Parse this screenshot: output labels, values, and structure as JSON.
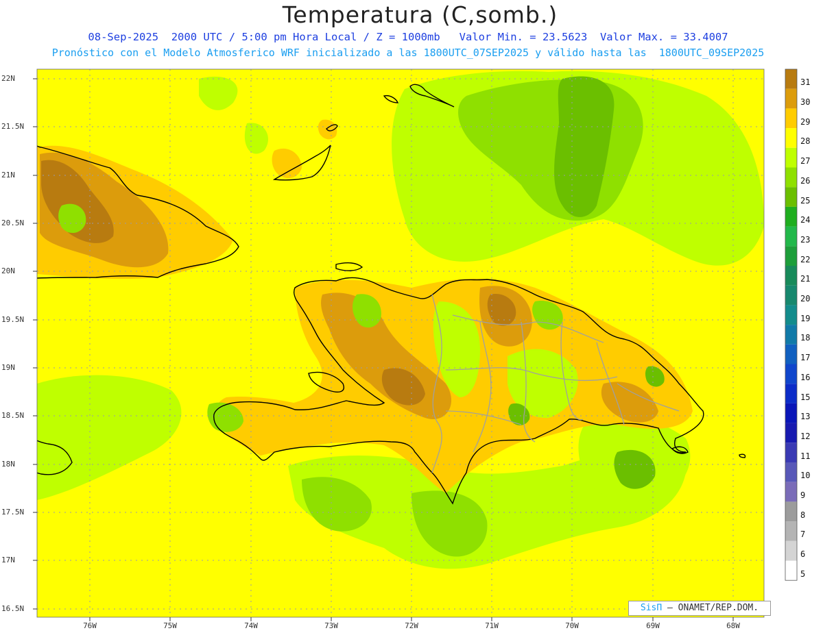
{
  "header": {
    "title": "Temperatura (C,somb.)",
    "line1": "08-Sep-2025  2000 UTC / 5:00 pm Hora Local / Z = 1000mb   Valor Min. = 23.5623  Valor Max. = 33.4007",
    "line2": "Pronóstico con el Modelo Atmosferico WRF inicializado a las 1800UTC_07SEP2025 y válido hasta las  1800UTC_09SEP2025"
  },
  "axes": {
    "lat_labels": [
      "22N",
      "21.5N",
      "21N",
      "20.5N",
      "20N",
      "19.5N",
      "19N",
      "18.5N",
      "18N",
      "17.5N",
      "17N",
      "16.5N"
    ],
    "lon_labels": [
      "76W",
      "75W",
      "74W",
      "73W",
      "72W",
      "71W",
      "70W",
      "69W",
      "68W"
    ]
  },
  "colorbar": {
    "labels": [
      "31",
      "30",
      "29",
      "28",
      "27",
      "26",
      "25",
      "24",
      "23",
      "22",
      "21",
      "20",
      "19",
      "18",
      "17",
      "16",
      "15",
      "13",
      "12",
      "11",
      "10",
      "9",
      "8",
      "7",
      "6",
      "5"
    ],
    "colors": [
      "#b87b10",
      "#dc9c0c",
      "#ffcc00",
      "#ffff00",
      "#bfff00",
      "#8fe000",
      "#6bbf00",
      "#1fae1f",
      "#22b84a",
      "#1d9e3a",
      "#188a5a",
      "#17886e",
      "#138c8c",
      "#117aa8",
      "#1160c0",
      "#1046cc",
      "#0c2cc8",
      "#0a16b8",
      "#181ab0",
      "#3a3ab4",
      "#5858b8",
      "#7a6cb8",
      "#9c9c9c",
      "#b4b4b4",
      "#d4d4d4",
      "#ffffff"
    ]
  },
  "map_colors": {
    "ocean": "#ffff00",
    "warm_land": "#ffcc00",
    "hot": "#dc9c0c",
    "hottest": "#b87b10",
    "cool": "#bfff00",
    "cooler": "#8fe000",
    "coolest": "#6bbf00",
    "coast": "#000000",
    "borders": "#a0a0a0"
  },
  "credit": {
    "brand": "SisΠ",
    "text": "– ONAMET/REP.DOM."
  }
}
